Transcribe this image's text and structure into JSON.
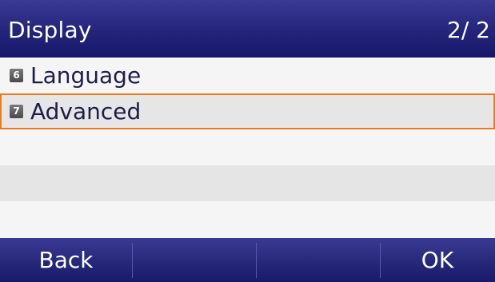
{
  "header": {
    "title": "Display",
    "page_indicator": "2/ 2"
  },
  "menu": {
    "items": [
      {
        "key": "6",
        "label": "Language"
      },
      {
        "key": "7",
        "label": "Advanced",
        "selected": true
      }
    ]
  },
  "softkeys": [
    {
      "label": "Back"
    },
    {
      "label": ""
    },
    {
      "label": ""
    },
    {
      "label": "OK"
    }
  ],
  "colors": {
    "header_bar": "#24247a",
    "selection_border": "#ef7a1e",
    "row_light": "#f5f5f5",
    "row_dark": "#e5e5e5"
  }
}
